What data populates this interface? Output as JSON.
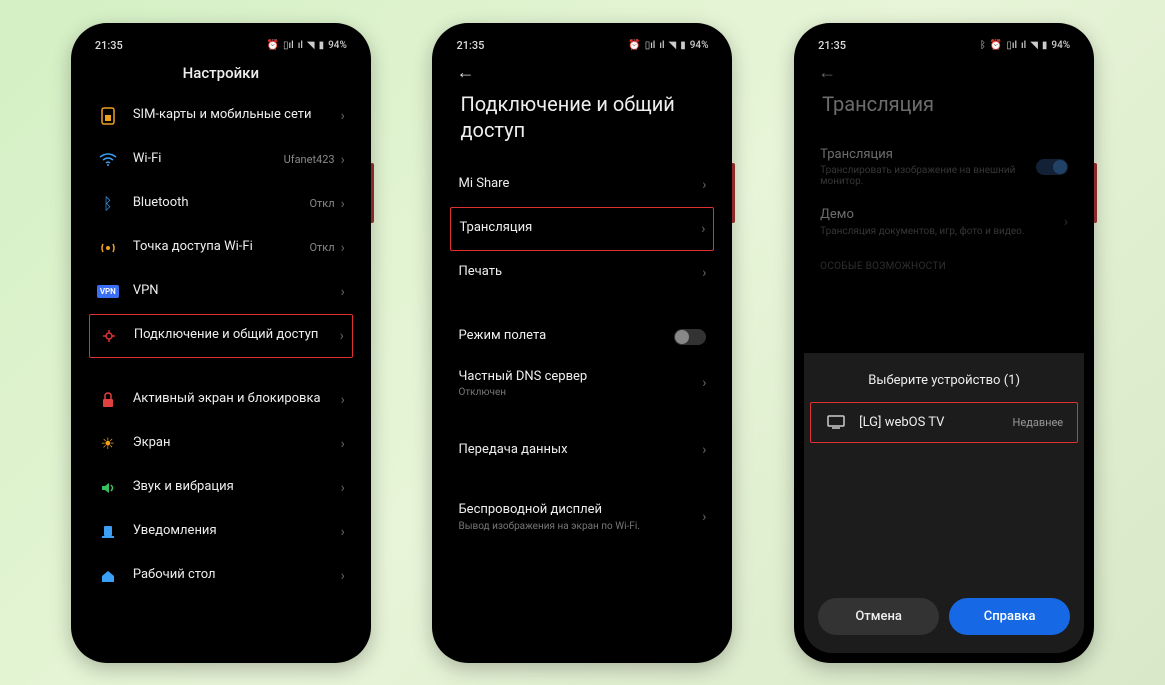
{
  "status": {
    "time": "21:35",
    "battery": "94%"
  },
  "phone1": {
    "title": "Настройки",
    "items": [
      {
        "label": "SIM-карты и мобильные сети",
        "icon": "sim"
      },
      {
        "label": "Wi-Fi",
        "icon": "wifi",
        "value": "Ufanet423"
      },
      {
        "label": "Bluetooth",
        "icon": "bt",
        "value": "Откл"
      },
      {
        "label": "Точка доступа Wi-Fi",
        "icon": "hotspot",
        "value": "Откл"
      },
      {
        "label": "VPN",
        "icon": "vpn"
      },
      {
        "label": "Подключение и общий доступ",
        "icon": "share",
        "highlight": true
      }
    ],
    "items2": [
      {
        "label": "Активный экран и блокировка",
        "icon": "lock"
      },
      {
        "label": "Экран",
        "icon": "display"
      },
      {
        "label": "Звук и вибрация",
        "icon": "sound"
      },
      {
        "label": "Уведомления",
        "icon": "notif"
      },
      {
        "label": "Рабочий стол",
        "icon": "home"
      }
    ]
  },
  "phone2": {
    "title": "Подключение и общий доступ",
    "items": [
      {
        "label": "Mi Share"
      },
      {
        "label": "Трансляция",
        "highlight": true
      },
      {
        "label": "Печать"
      }
    ],
    "items2": [
      {
        "label": "Режим полета",
        "toggle": false
      },
      {
        "label": "Частный DNS сервер",
        "sub": "Отключен"
      }
    ],
    "items3": [
      {
        "label": "Передача данных"
      }
    ],
    "items4": [
      {
        "label": "Беспроводной дисплей",
        "sub": "Вывод изображения на экран по Wi-Fi."
      }
    ]
  },
  "phone3": {
    "title": "Трансляция",
    "cast": {
      "label": "Трансляция",
      "sub": "Транслировать изображение на внешний монитор."
    },
    "demo": {
      "label": "Демо",
      "sub": "Трансляция документов, игр, фото и видео."
    },
    "section": "ОСОБЫЕ ВОЗМОЖНОСТИ",
    "sheet_title": "Выберите устройство (1)",
    "device": {
      "name": "[LG] webOS TV",
      "status": "Недавнее"
    },
    "cancel": "Отмена",
    "help": "Справка"
  }
}
